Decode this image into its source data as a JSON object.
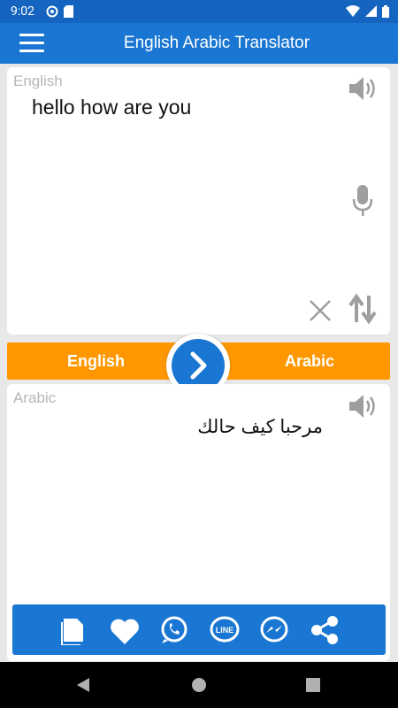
{
  "status": {
    "time": "9:02"
  },
  "app": {
    "title": "English Arabic Translator"
  },
  "source": {
    "label": "English",
    "text": "hello how are you"
  },
  "target": {
    "label": "Arabic",
    "text": "مرحبا كيف حالك"
  },
  "bar": {
    "from_lang": "English",
    "to_lang": "Arabic"
  },
  "colors": {
    "primary": "#1976d2",
    "status_bar": "#1565c0",
    "accent": "#ff9800",
    "label_gray": "#b7b7b7",
    "icon_gray": "#9e9e9e"
  },
  "icons": {
    "menu": "hamburger-icon",
    "speaker": "speaker-icon",
    "mic": "microphone-icon",
    "clear": "close-icon",
    "swap": "swap-vertical-icon",
    "translate": "chevron-right-icon",
    "share_bar": [
      "copy-icon",
      "heart-icon",
      "whatsapp-icon",
      "line-icon",
      "messenger-icon",
      "share-icon"
    ],
    "nav": [
      "back-icon",
      "home-icon",
      "recents-icon"
    ]
  }
}
